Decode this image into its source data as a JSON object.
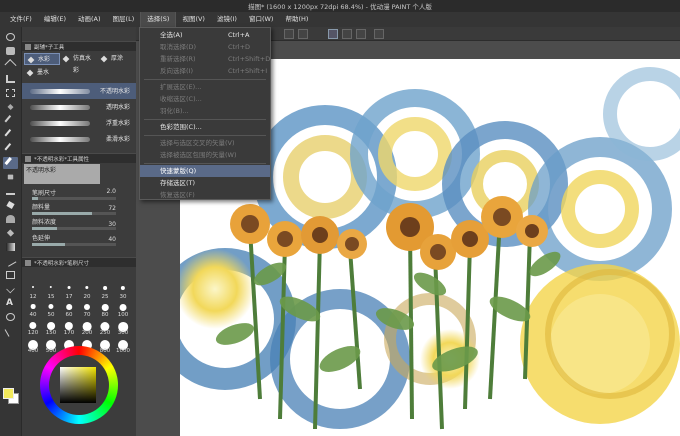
{
  "window": {
    "title": "描图* (1600 x 1200px 72dpi 68.4%) - 优动漫 PAINT 个人版"
  },
  "menubar": {
    "items": [
      "文件(F)",
      "编辑(E)",
      "动画(A)",
      "图层(L)",
      "选择(S)",
      "视图(V)",
      "滤镜(I)",
      "窗口(W)",
      "帮助(H)"
    ],
    "active": "选择(S)"
  },
  "select_menu": {
    "items": [
      {
        "label": "全选(A)",
        "shortcut": "Ctrl+A",
        "state": "enabled"
      },
      {
        "label": "取消选择(D)",
        "shortcut": "Ctrl+D",
        "state": "disabled"
      },
      {
        "label": "重新选择(R)",
        "shortcut": "Ctrl+Shift+D",
        "state": "disabled"
      },
      {
        "label": "反向选择(I)",
        "shortcut": "Ctrl+Shift+I",
        "state": "disabled"
      },
      {
        "label": "扩展选区(E)...",
        "shortcut": "",
        "state": "disabled"
      },
      {
        "label": "收缩选区(C)...",
        "shortcut": "",
        "state": "disabled"
      },
      {
        "label": "羽化(B)...",
        "shortcut": "",
        "state": "disabled"
      },
      {
        "label": "色彩范围(C)...",
        "shortcut": "",
        "state": "enabled"
      },
      {
        "label": "选择与选区交叉的矢量(V)",
        "shortcut": "",
        "state": "disabled"
      },
      {
        "label": "选择被选区包围的矢量(W)",
        "shortcut": "",
        "state": "disabled"
      },
      {
        "label": "快速蒙版(Q)",
        "shortcut": "",
        "state": "highlighted"
      },
      {
        "label": "存储选区(T)",
        "shortcut": "",
        "state": "enabled"
      },
      {
        "label": "恢复选区(F)",
        "shortcut": "",
        "state": "disabled"
      }
    ]
  },
  "subtool_panel": {
    "title": "副辅*子工具",
    "subtools": [
      "水彩",
      "仿真水彩",
      "厚涂",
      "墨水"
    ],
    "selected": "水彩",
    "brushes": [
      "不透明水彩",
      "透明水彩",
      "浮重水彩",
      "柔滑水彩"
    ],
    "selected_brush": "不透明水彩"
  },
  "tool_property": {
    "title": "*不透明水彩*工具属性",
    "brush_name": "不透明水彩",
    "props": [
      {
        "label": "笔刷尺寸",
        "value": "2.0"
      },
      {
        "label": "颜料量",
        "value": "72"
      },
      {
        "label": "颜料浓度",
        "value": "30"
      },
      {
        "label": "色延伸",
        "value": "40"
      }
    ]
  },
  "brush_size": {
    "title": "*不透明水彩*笔刷尺寸",
    "sizes": [
      "12",
      "15",
      "17",
      "20",
      "25",
      "30",
      "40",
      "50",
      "60",
      "70",
      "80",
      "100",
      "120",
      "150",
      "170",
      "200",
      "250",
      "300",
      "400",
      "500",
      "600",
      "700",
      "800",
      "1000"
    ]
  },
  "colors": {
    "foreground": "#f3ea5c",
    "background": "#ffffff",
    "accent": "#5a6a88"
  }
}
